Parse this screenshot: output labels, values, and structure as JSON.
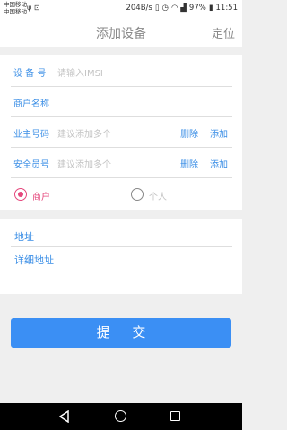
{
  "status_bar": {
    "carrier_1": "中国移动",
    "carrier_2": "中国移动",
    "speed": "204B/s",
    "battery": "97%",
    "time": "11:51"
  },
  "header": {
    "title": "添加设备",
    "locate_label": "定位"
  },
  "form": {
    "device_no": {
      "label": "设 备 号",
      "placeholder": "请输入IMSI"
    },
    "merchant_name": {
      "label": "商户名称"
    },
    "owner_phone": {
      "label": "业主号码",
      "placeholder": "建议添加多个",
      "delete": "删除",
      "add": "添加"
    },
    "security_phone": {
      "label": "安全员号",
      "placeholder": "建议添加多个",
      "delete": "删除",
      "add": "添加"
    },
    "type": {
      "options": [
        "商户",
        "个人"
      ],
      "selected": "商户"
    }
  },
  "address": {
    "address_label": "地址",
    "detail_label": "详细地址"
  },
  "submit_label": "提 交",
  "colors": {
    "accent": "#3a8ee6",
    "button": "#3b8ff4",
    "radio_selected": "#e5477c"
  }
}
